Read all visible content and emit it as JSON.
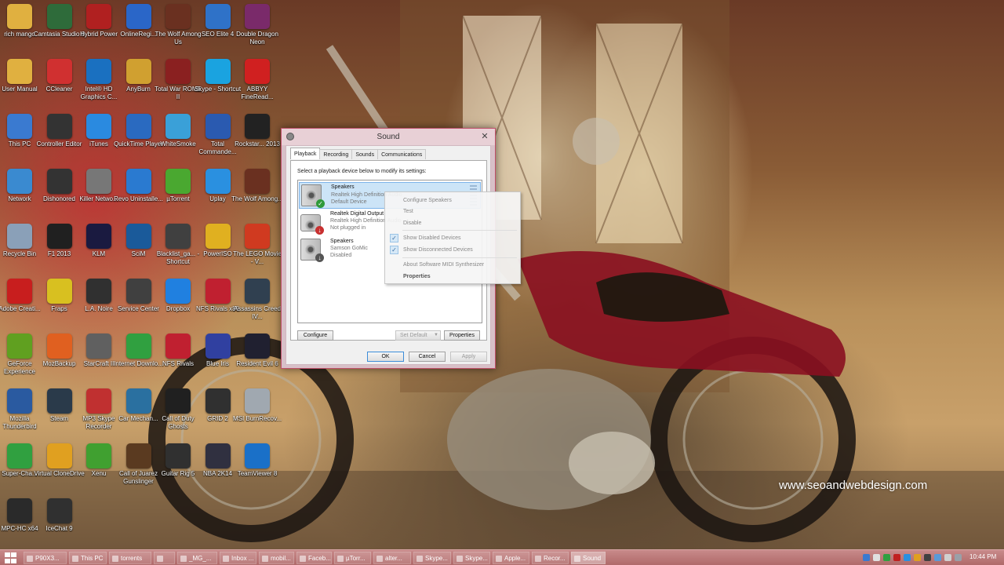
{
  "desktop": {
    "icons": [
      {
        "label": "rich mango",
        "icon": "folder-icon",
        "color": "#e0b040"
      },
      {
        "label": "Camtasia Studio 8",
        "icon": "camtasia-icon",
        "color": "#2e6b3a"
      },
      {
        "label": "Hybrid Power",
        "icon": "hybrid-power-icon",
        "color": "#b02020"
      },
      {
        "label": "OnlineRegi...",
        "icon": "onlineregi-icon",
        "color": "#2a66c8"
      },
      {
        "label": "The Wolf Among Us",
        "icon": "wolf-icon",
        "color": "#6a3020"
      },
      {
        "label": "SEO Elite 4",
        "icon": "seo-elite-icon",
        "color": "#2f72c8"
      },
      {
        "label": "Double Dragon Neon",
        "icon": "double-dragon-icon",
        "color": "#7a2a6a"
      },
      {
        "label": "User Manual",
        "icon": "folder-icon",
        "color": "#e0b040"
      },
      {
        "label": "CCleaner",
        "icon": "ccleaner-icon",
        "color": "#d03030"
      },
      {
        "label": "Intel® HD Graphics C...",
        "icon": "intel-icon",
        "color": "#1a70c0"
      },
      {
        "label": "AnyBurn",
        "icon": "anyburn-icon",
        "color": "#d0a030"
      },
      {
        "label": "Total War ROME II",
        "icon": "rome-icon",
        "color": "#8a2020"
      },
      {
        "label": "Skype - Shortcut",
        "icon": "skype-icon",
        "color": "#1aa3e0"
      },
      {
        "label": "ABBYY FineRead...",
        "icon": "abbyy-icon",
        "color": "#d02020"
      },
      {
        "label": "This PC",
        "icon": "this-pc-icon",
        "color": "#3a7ad0"
      },
      {
        "label": "Controller Editor",
        "icon": "controller-icon",
        "color": "#333333"
      },
      {
        "label": "iTunes",
        "icon": "itunes-icon",
        "color": "#2a8ae0"
      },
      {
        "label": "QuickTime Player",
        "icon": "quicktime-icon",
        "color": "#2a6ac0"
      },
      {
        "label": "WhiteSmoke",
        "icon": "whitesmoke-icon",
        "color": "#3aa0d8"
      },
      {
        "label": "Total Commande...",
        "icon": "total-commander-icon",
        "color": "#2a5ab0"
      },
      {
        "label": "Rockstar... 2013",
        "icon": "rockstar-icon",
        "color": "#222222"
      },
      {
        "label": "Network",
        "icon": "network-icon",
        "color": "#3a8ad0"
      },
      {
        "label": "Dishonored",
        "icon": "dishonored-icon",
        "color": "#333333"
      },
      {
        "label": "Killer Netwo...",
        "icon": "killer-icon",
        "color": "#777777"
      },
      {
        "label": "Revo Uninstalle...",
        "icon": "revo-icon",
        "color": "#2a7ad0"
      },
      {
        "label": "µTorrent",
        "icon": "utorrent-icon",
        "color": "#4aa830"
      },
      {
        "label": "Uplay",
        "icon": "uplay-icon",
        "color": "#2a90e0"
      },
      {
        "label": "The Wolf Among...",
        "icon": "wolf-icon",
        "color": "#6a3020"
      },
      {
        "label": "Recycle Bin",
        "icon": "recycle-bin-icon",
        "color": "#8aa0b8"
      },
      {
        "label": "F1 2013",
        "icon": "f1-icon",
        "color": "#202020"
      },
      {
        "label": "KLM",
        "icon": "klm-icon",
        "color": "#1a1a40"
      },
      {
        "label": "SciM",
        "icon": "scim-icon",
        "color": "#1a5a9a"
      },
      {
        "label": "Blacklist_ga... - Shortcut",
        "icon": "blacklist-icon",
        "color": "#404040"
      },
      {
        "label": "PowerISO",
        "icon": "poweriso-icon",
        "color": "#e0b020"
      },
      {
        "label": "The LEGO Movie - V...",
        "icon": "lego-icon",
        "color": "#d03a20"
      },
      {
        "label": "Adobe Creati...",
        "icon": "adobe-icon",
        "color": "#c81e1e"
      },
      {
        "label": "Fraps",
        "icon": "fraps-icon",
        "color": "#d8c020"
      },
      {
        "label": "L.A. Noire",
        "icon": "la-noire-icon",
        "color": "#303030"
      },
      {
        "label": "Service Center",
        "icon": "service-center-icon",
        "color": "#404040"
      },
      {
        "label": "Dropbox",
        "icon": "dropbox-icon",
        "color": "#2080e0"
      },
      {
        "label": "NFS Rivals x86",
        "icon": "nfs-icon",
        "color": "#c02030"
      },
      {
        "label": "Assassins Creed IV...",
        "icon": "assassins-icon",
        "color": "#304050"
      },
      {
        "label": "GeForce Experience",
        "icon": "geforce-icon",
        "color": "#60a020"
      },
      {
        "label": "MozBackup",
        "icon": "mozbackup-icon",
        "color": "#e06020"
      },
      {
        "label": "StarCraft II",
        "icon": "starcraft-icon",
        "color": "#606060"
      },
      {
        "label": "Internet Downlo...",
        "icon": "idm-icon",
        "color": "#30a040"
      },
      {
        "label": "NFS Rivals",
        "icon": "nfs-icon",
        "color": "#c02030"
      },
      {
        "label": "Blue Iris",
        "icon": "blue-iris-icon",
        "color": "#3040a0"
      },
      {
        "label": "Resident Evil 6",
        "icon": "resident-evil-icon",
        "color": "#202030"
      },
      {
        "label": "Mozilla Thunderbird",
        "icon": "thunderbird-icon",
        "color": "#2a5aa0"
      },
      {
        "label": "Steam",
        "icon": "steam-icon",
        "color": "#2a3a4a"
      },
      {
        "label": "MP3 Skype Recorder",
        "icon": "mp3-skype-icon",
        "color": "#c03030"
      },
      {
        "label": "Car Mechan...",
        "icon": "car-mechanic-icon",
        "color": "#2a70a0"
      },
      {
        "label": "Call of Duty Ghosts",
        "icon": "cod-icon",
        "color": "#202020"
      },
      {
        "label": "GRID 2",
        "icon": "grid2-icon",
        "color": "#303030"
      },
      {
        "label": "MSI BurnRecov...",
        "icon": "msi-icon",
        "color": "#a0a8b0"
      },
      {
        "label": "Super-Cha...",
        "icon": "super-charger-icon",
        "color": "#30a040"
      },
      {
        "label": "Virtual CloneDrive",
        "icon": "clonedrive-icon",
        "color": "#e0a020"
      },
      {
        "label": "Xenu",
        "icon": "xenu-icon",
        "color": "#40a030"
      },
      {
        "label": "Call of Juarez Gunslinger",
        "icon": "juarez-icon",
        "color": "#5a3a20"
      },
      {
        "label": "Guitar Rig 5",
        "icon": "guitar-rig-icon",
        "color": "#303030"
      },
      {
        "label": "NBA 2K14",
        "icon": "nba-icon",
        "color": "#303040"
      },
      {
        "label": "TeamViewer 8",
        "icon": "teamviewer-icon",
        "color": "#1a70c8"
      },
      {
        "label": "MPC-HC x64",
        "icon": "mpc-icon",
        "color": "#2a2a2a"
      },
      {
        "label": "IceChat 9",
        "icon": "icechat-icon",
        "color": "#303030"
      }
    ]
  },
  "watermark": "www.seoandwebdesign.com",
  "dialog": {
    "title": "Sound",
    "close_glyph": "✕",
    "tabs": [
      "Playback",
      "Recording",
      "Sounds",
      "Communications"
    ],
    "instruction": "Select a playback device below to modify its settings:",
    "devices": [
      {
        "name": "Speakers",
        "detail": "Realtek High Definition Audio",
        "status": "Default Device",
        "status_icon": "check-icon",
        "selected": true
      },
      {
        "name": "Realtek Digital Output",
        "detail": "Realtek High Definition Audio",
        "status": "Not plugged in",
        "status_icon": "unplugged-icon",
        "selected": false
      },
      {
        "name": "Speakers",
        "detail": "Samson GoMic",
        "status": "Disabled",
        "status_icon": "disabled-icon",
        "selected": false
      }
    ],
    "buttons": {
      "configure": "Configure",
      "set_default": "Set Default",
      "properties": "Properties",
      "ok": "OK",
      "cancel": "Cancel",
      "apply": "Apply"
    }
  },
  "context_menu": {
    "items": [
      {
        "label": "Configure Speakers"
      },
      {
        "label": "Test"
      },
      {
        "label": "Disable"
      },
      {
        "label": "Show Disabled Devices",
        "checked": true
      },
      {
        "label": "Show Disconnected Devices",
        "checked": true
      },
      {
        "label": "About Software MIDI Synthesizer"
      },
      {
        "label": "Properties",
        "bold": true
      }
    ]
  },
  "taskbar": {
    "buttons": [
      {
        "label": "P90X3..."
      },
      {
        "label": "This PC"
      },
      {
        "label": "torrents"
      },
      {
        "label": ""
      },
      {
        "label": "_MG_..."
      },
      {
        "label": "Inbox ..."
      },
      {
        "label": "mobil..."
      },
      {
        "label": "Faceb..."
      },
      {
        "label": "µTorr..."
      },
      {
        "label": "alter..."
      },
      {
        "label": "Skype..."
      },
      {
        "label": "Skype..."
      },
      {
        "label": "Apple..."
      },
      {
        "label": "Recor..."
      },
      {
        "label": "Sound",
        "active": true
      }
    ],
    "clock": "10:44 PM"
  }
}
